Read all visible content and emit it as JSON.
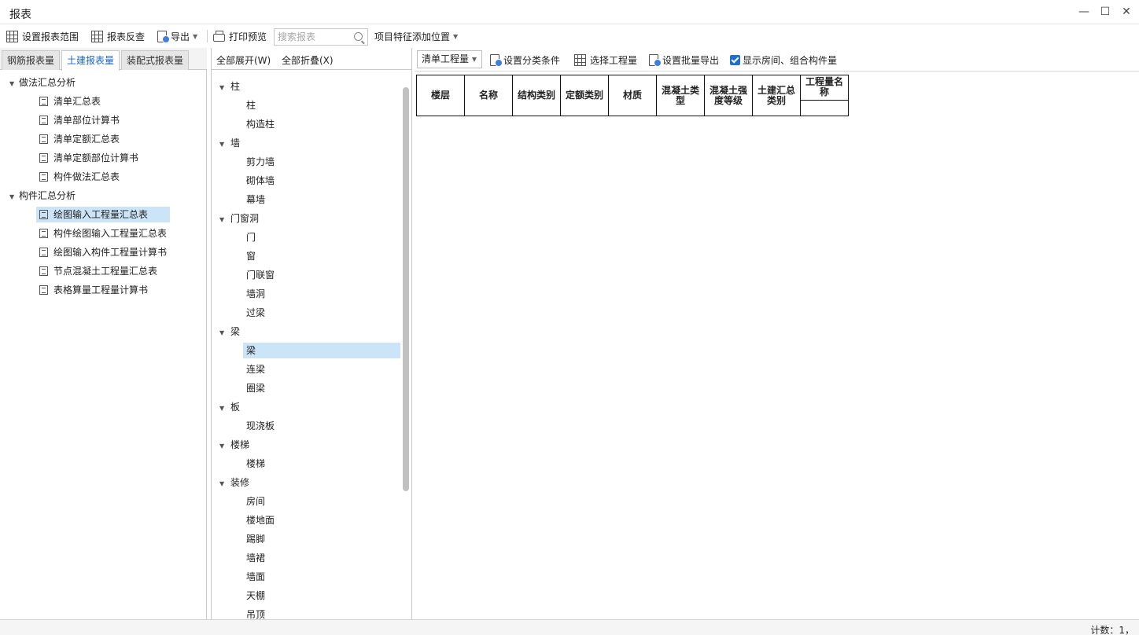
{
  "window": {
    "title": "报表",
    "minimize": "—",
    "maximize": "☐",
    "close": "✕"
  },
  "toolbar": {
    "set_range": "设置报表范围",
    "reverse_check": "报表反查",
    "export": "导出",
    "print_preview": "打印预览",
    "search_placeholder": "搜索报表",
    "feature_position": "项目特征添加位置"
  },
  "left": {
    "tabs": [
      "钢筋报表量",
      "土建报表量",
      "装配式报表量"
    ],
    "active_tab": "土建报表量",
    "groups": [
      {
        "label": "做法汇总分析",
        "items": [
          "清单汇总表",
          "清单部位计算书",
          "清单定额汇总表",
          "清单定额部位计算书",
          "构件做法汇总表"
        ]
      },
      {
        "label": "构件汇总分析",
        "items": [
          "绘图输入工程量汇总表",
          "构件绘图输入工程量汇总表",
          "绘图输入构件工程量计算书",
          "节点混凝土工程量汇总表",
          "表格算量工程量计算书"
        ]
      }
    ],
    "selected_item": "绘图输入工程量汇总表"
  },
  "middle": {
    "expand_all": "全部展开(W)",
    "collapse_all": "全部折叠(X)",
    "tree": [
      {
        "label": "柱",
        "children": [
          "柱",
          "构造柱"
        ]
      },
      {
        "label": "墙",
        "children": [
          "剪力墙",
          "砌体墙",
          "幕墙"
        ]
      },
      {
        "label": "门窗洞",
        "children": [
          "门",
          "窗",
          "门联窗",
          "墙洞",
          "过梁"
        ]
      },
      {
        "label": "梁",
        "children": [
          "梁",
          "连梁",
          "圈梁"
        ]
      },
      {
        "label": "板",
        "children": [
          "现浇板"
        ]
      },
      {
        "label": "楼梯",
        "children": [
          "楼梯"
        ]
      },
      {
        "label": "装修",
        "children": [
          "房间",
          "楼地面",
          "踢脚",
          "墙裙",
          "墙面",
          "天棚",
          "吊顶"
        ]
      }
    ],
    "selected": "梁"
  },
  "right": {
    "dropdown_value": "清单工程量",
    "set_classification": "设置分类条件",
    "select_quantity": "选择工程量",
    "batch_export": "设置批量导出",
    "show_rooms": "显示房间、组合构件量",
    "show_rooms_checked": true,
    "table_headers": [
      "楼层",
      "名称",
      "结构类别",
      "定额类别",
      "材质",
      "混凝土类型",
      "混凝土强度等级",
      "土建汇总类别",
      "工程量名称"
    ]
  },
  "status": {
    "count": "计数：1，"
  }
}
